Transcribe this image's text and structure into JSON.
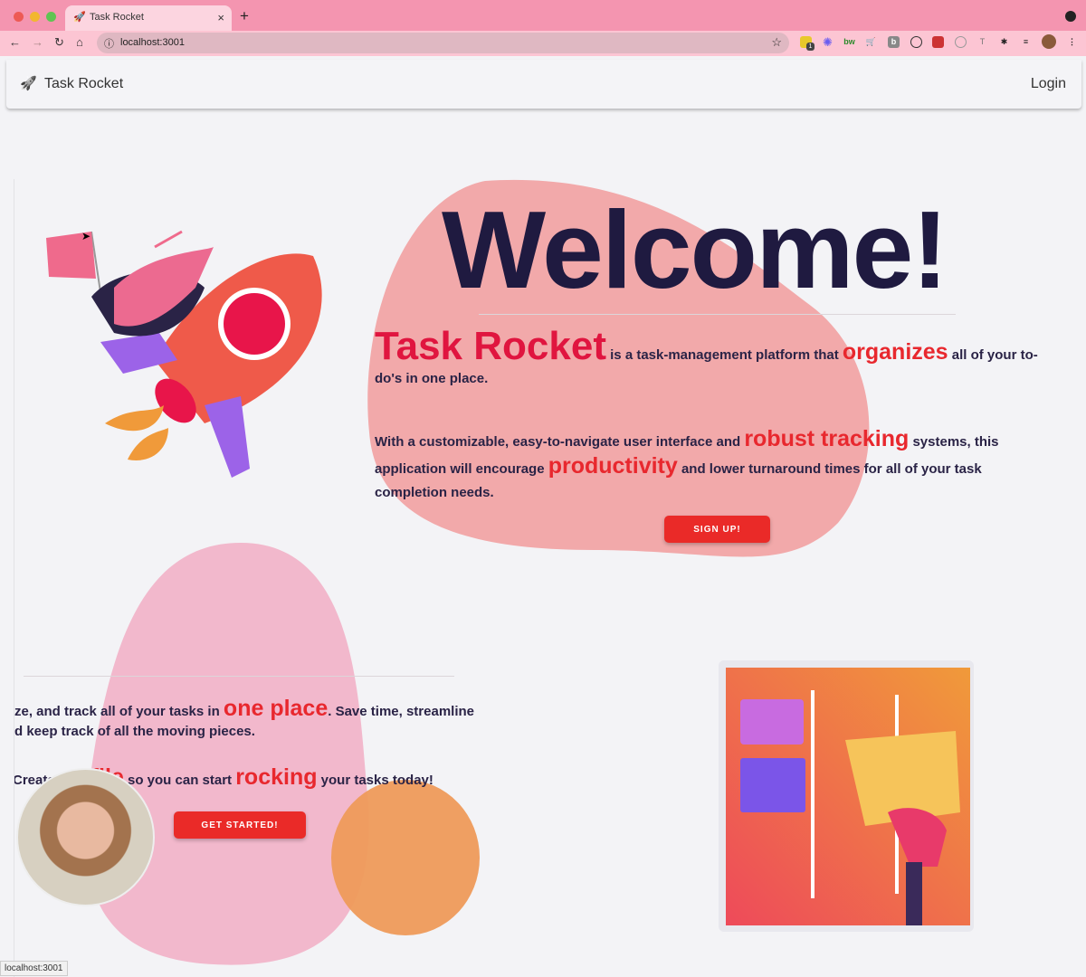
{
  "browser": {
    "tab_title": "Task Rocket",
    "url": "localhost:3001",
    "status_url": "localhost:3001",
    "extension_badge": "1"
  },
  "navbar": {
    "brand": "Task Rocket",
    "login": "Login"
  },
  "hero": {
    "title": "Welcome!",
    "brand": "Task Rocket",
    "p1_a": " is a task-management platform that ",
    "p1_hl": "organizes",
    "p1_b": " all of your to-do's in one place.",
    "p2_a": "With a customizable, easy-to-navigate user interface and ",
    "p2_hl1": "robust tracking",
    "p2_b": " systems, this application will encourage ",
    "p2_hl2": "productivity",
    "p2_c": " and lower turnaround times for all of your task completion needs.",
    "signup": "SIGN UP!"
  },
  "second": {
    "l1_a": "ze, and track all of your tasks in ",
    "l1_hl": "one place",
    "l1_b": ". Save time, streamline",
    "l2": "d keep track of all the moving pieces.",
    "l3_a": "Create",
    "l3_hl1": "file",
    "l3_b": " so you can start ",
    "l3_hl2": "rocking",
    "l3_c": " your tasks today!",
    "cta": "GET STARTED!"
  },
  "colors": {
    "accent": "#e8282e",
    "title": "#1f1a40",
    "blob_pink": "#f2a9aa",
    "blob_orange": "#ee9a5a"
  }
}
